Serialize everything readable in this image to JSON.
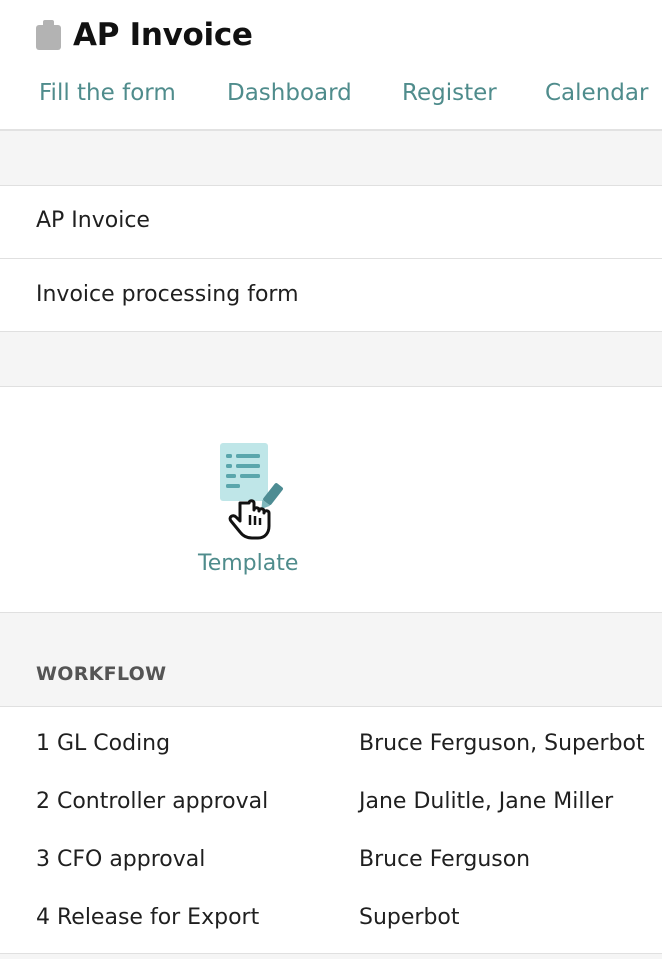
{
  "app": {
    "title": "AP Invoice",
    "icon": "clipboard-icon"
  },
  "tabs": [
    {
      "label": "Fill the form"
    },
    {
      "label": "Dashboard"
    },
    {
      "label": "Register"
    },
    {
      "label": "Calendar"
    }
  ],
  "form": {
    "name": "AP Invoice",
    "description": "Invoice processing form"
  },
  "template": {
    "label": "Template",
    "icon": "template-document-icon"
  },
  "workflow": {
    "heading": "WORKFLOW",
    "steps": [
      {
        "step": "1 GL Coding",
        "users": "Bruce Ferguson, Superbot"
      },
      {
        "step": "2 Controller approval",
        "users": "Jane Dulitle, Jane Miller"
      },
      {
        "step": "3 CFO approval",
        "users": "Bruce Ferguson"
      },
      {
        "step": "4 Release for Export",
        "users": "Superbot"
      }
    ]
  },
  "colors": {
    "accent": "#4f8c8c",
    "template_icon": "#bfe6e8",
    "band": "#f5f5f5"
  }
}
